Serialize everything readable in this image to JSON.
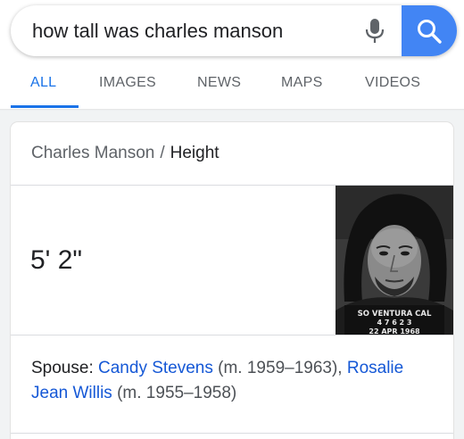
{
  "search": {
    "query": "how tall was charles manson"
  },
  "tabs": [
    {
      "label": "ALL",
      "active": true
    },
    {
      "label": "IMAGES",
      "active": false
    },
    {
      "label": "NEWS",
      "active": false
    },
    {
      "label": "MAPS",
      "active": false
    },
    {
      "label": "VIDEOS",
      "active": false
    }
  ],
  "card": {
    "entity": "Charles Manson",
    "separator": "/",
    "attribute": "Height",
    "answer": "5' 2\"",
    "image": {
      "caption_line1": "SO VENTURA CAL",
      "caption_line2": "4 7 6 2 3",
      "caption_line3": "22 APR 1968"
    },
    "spouse": {
      "label": "Spouse:",
      "entries": [
        {
          "name": "Candy Stevens",
          "dates": "(m. 1959–1963),"
        },
        {
          "name": "Rosalie Jean Willis",
          "dates": "(m. 1955–1958)"
        }
      ]
    }
  },
  "colors": {
    "accent": "#1a73e8",
    "link": "#1558d6",
    "search_button": "#4285f4"
  },
  "icons": [
    "microphone-icon",
    "search-icon"
  ]
}
